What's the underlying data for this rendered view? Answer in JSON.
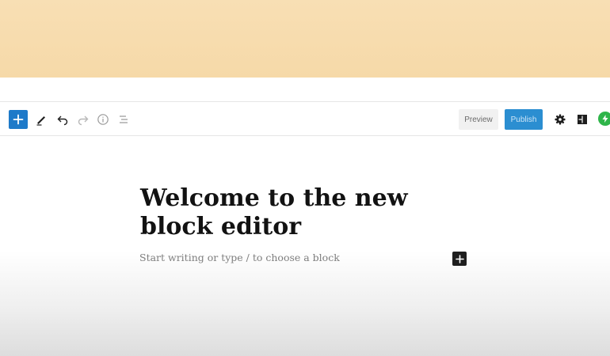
{
  "toolbar": {
    "add_block": "add-block",
    "tools": "edit-tool",
    "undo": "undo",
    "redo": "redo",
    "info": "info",
    "outline": "block-navigation",
    "preview_label": "Preview",
    "publish_label": "Publish",
    "settings": "settings",
    "plugin": "layout",
    "jetpack": "jetpack"
  },
  "editor": {
    "title": "Welcome to the new block editor",
    "placeholder": "Start writing or type / to choose a block"
  },
  "colors": {
    "banner": "#f6d9a8",
    "accent": "#1e7ac9",
    "publish": "#2b8ed1",
    "jetpack": "#2fb54a"
  }
}
